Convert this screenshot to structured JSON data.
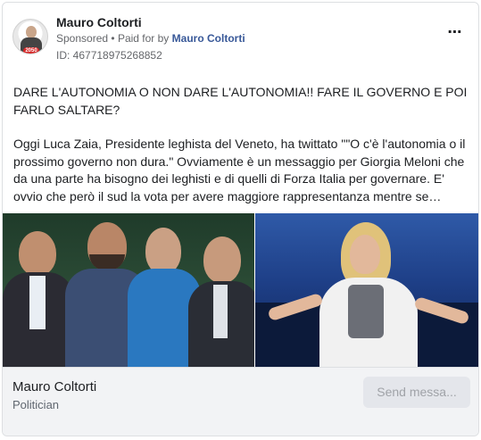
{
  "post": {
    "page_name": "Mauro Coltorti",
    "sponsored_label": "Sponsored",
    "separator": "•",
    "paid_for_prefix": "Paid for by",
    "paid_for_name": "Mauro Coltorti",
    "ad_id": "ID: 467718975268852",
    "more_icon": "more-horizontal-icon",
    "avatar_badge": "2050",
    "headline": "DARE L'AUTONOMIA O NON DARE L'AUTONOMIA!! FARE IL GOVERNO E POI FARLO SALTARE?",
    "body": "Oggi Luca Zaia, Presidente leghista del Veneto, ha twittato \"\"O c'è l'autonomia o il prossimo governo non dura.\" Ovviamente è un messaggio per Giorgia Meloni che da una parte ha bisogno dei leghisti e di quelli di Forza Italia per governare. E' ovvio che però il sud la vota per avere maggiore rappresentanza mentre se approvasse..."
  },
  "footer": {
    "page_name": "Mauro Coltorti",
    "category": "Politician",
    "send_button_label": "Send messa..."
  },
  "colors": {
    "link_blue": "#385898",
    "footer_bg": "#f2f3f5",
    "button_disabled_bg": "#e4e6eb"
  }
}
